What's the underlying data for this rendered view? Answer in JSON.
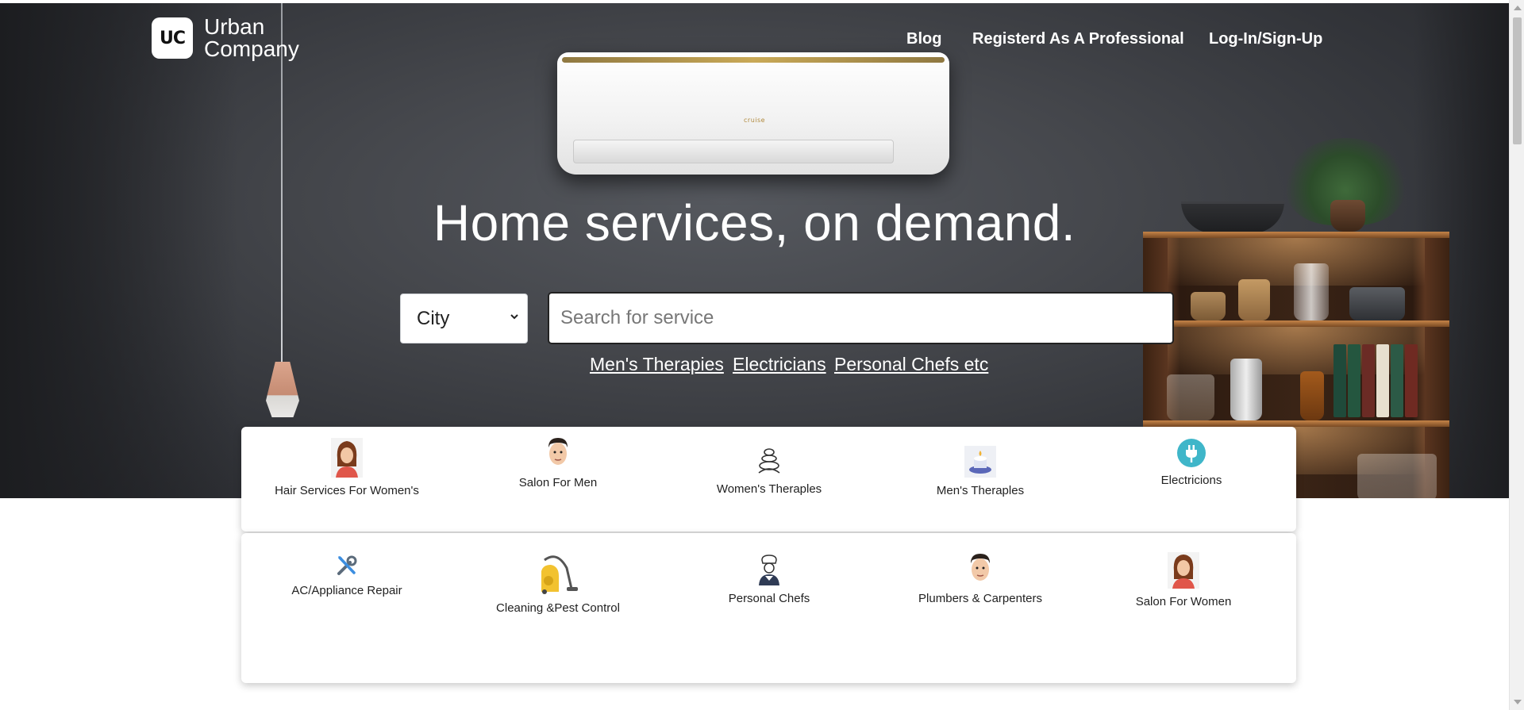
{
  "header": {
    "logo_mark": "UC",
    "logo_line1": "Urban",
    "logo_line2": "Company",
    "nav": {
      "blog": "Blog",
      "professional": "Registerd As A Professional",
      "login": "Log-In/Sign-Up"
    }
  },
  "hero": {
    "ac_brand": "cruise",
    "headline": "Home services, on demand.",
    "city_select": {
      "selected": "City"
    },
    "search": {
      "placeholder": "Search for service",
      "value": ""
    },
    "quick_links": [
      "Men's Therapies",
      "Electricians",
      "Personal Chefs etc"
    ]
  },
  "services_row1": [
    {
      "label": "Hair Services For Women's",
      "icon": "woman-avatar-icon"
    },
    {
      "label": "Salon For Men",
      "icon": "man-face-icon"
    },
    {
      "label": "Women's Theraples",
      "icon": "spa-stones-icon"
    },
    {
      "label": "Men's Theraples",
      "icon": "spa-candle-icon"
    },
    {
      "label": "Electricions",
      "icon": "plug-icon"
    }
  ],
  "services_row2": [
    {
      "label": "AC/Appliance Repair",
      "icon": "tools-icon"
    },
    {
      "label": "Cleaning &Pest Control",
      "icon": "vacuum-cleaner-icon"
    },
    {
      "label": "Personal Chefs",
      "icon": "chef-icon"
    },
    {
      "label": "Plumbers & Carpenters",
      "icon": "man-face-icon"
    },
    {
      "label": "Salon For Women",
      "icon": "woman-avatar-icon"
    }
  ],
  "colors": {
    "hero_bg": "#45474c",
    "text_on_hero": "#ffffff",
    "card_bg": "#ffffff",
    "plug_teal": "#3fb6c9"
  }
}
